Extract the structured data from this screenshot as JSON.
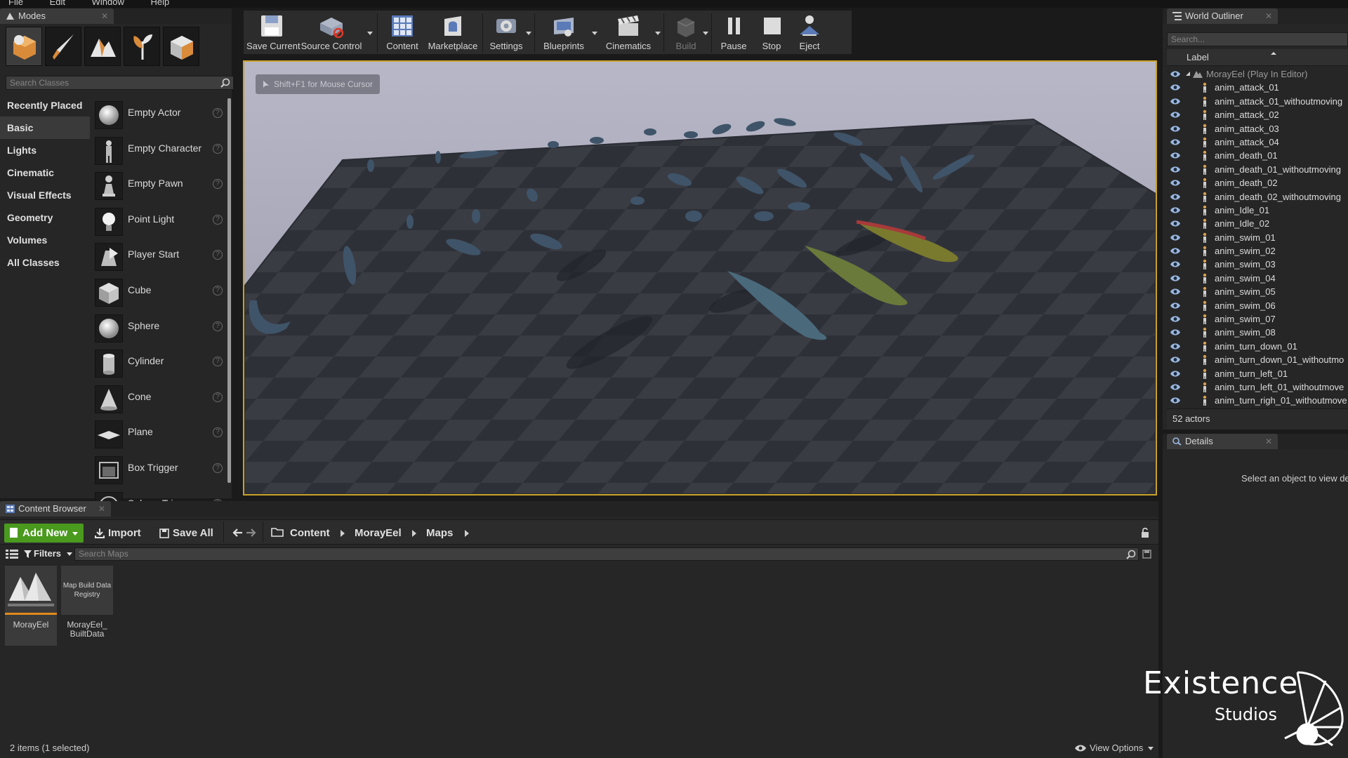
{
  "menu": [
    "File",
    "Edit",
    "Window",
    "Help"
  ],
  "modes": {
    "tab_label": "Modes",
    "search_placeholder": "Search Classes",
    "categories": [
      "Recently Placed",
      "Basic",
      "Lights",
      "Cinematic",
      "Visual Effects",
      "Geometry",
      "Volumes",
      "All Classes"
    ],
    "selected_category": "Basic",
    "items": [
      "Empty Actor",
      "Empty Character",
      "Empty Pawn",
      "Point Light",
      "Player Start",
      "Cube",
      "Sphere",
      "Cylinder",
      "Cone",
      "Plane",
      "Box Trigger",
      "Sphere Trigger"
    ]
  },
  "toolbar": {
    "save_current": "Save Current",
    "source_control": "Source Control",
    "content": "Content",
    "marketplace": "Marketplace",
    "settings": "Settings",
    "blueprints": "Blueprints",
    "cinematics": "Cinematics",
    "build": "Build",
    "pause": "Pause",
    "stop": "Stop",
    "eject": "Eject"
  },
  "viewport": {
    "mouse_hint": "Shift+F1 for Mouse Cursor"
  },
  "content_browser": {
    "tab_label": "Content Browser",
    "add_new": "Add New",
    "import": "Import",
    "save_all": "Save All",
    "breadcrumbs": [
      "Content",
      "MorayEel",
      "Maps"
    ],
    "filters": "Filters",
    "search_placeholder": "Search Maps",
    "assets": [
      {
        "name": "MorayEel",
        "selected": true
      },
      {
        "name": "MorayEel_BuiltData",
        "thumb_label": "Map Build Data Registry",
        "selected": false
      }
    ],
    "asset2_line1": "MorayEel_",
    "asset2_line2": "BuiltData",
    "status": "2 items (1 selected)",
    "view_options": "View Options"
  },
  "outliner": {
    "tab_label": "World Outliner",
    "search_placeholder": "Search...",
    "column_label": "Label",
    "root": "MorayEel (Play In Editor)",
    "actors": [
      "anim_attack_01",
      "anim_attack_01_withoutmoving",
      "anim_attack_02",
      "anim_attack_03",
      "anim_attack_04",
      "anim_death_01",
      "anim_death_01_withoutmoving",
      "anim_death_02",
      "anim_death_02_withoutmoving",
      "anim_Idle_01",
      "anim_Idle_02",
      "anim_swim_01",
      "anim_swim_02",
      "anim_swim_03",
      "anim_swim_04",
      "anim_swim_05",
      "anim_swim_06",
      "anim_swim_07",
      "anim_swim_08",
      "anim_turn_down_01",
      "anim_turn_down_01_withoutmo",
      "anim_turn_left_01",
      "anim_turn_left_01_withoutmove",
      "anim_turn_righ_01_withoutmove"
    ],
    "count": "52 actors"
  },
  "details": {
    "tab_label": "Details",
    "empty_msg": "Select an object to view de"
  },
  "logo": {
    "line1": "Existence",
    "line2": "Studios"
  },
  "colors": {
    "accent_selected": "#e08a1a",
    "add_new_green": "#4a9a1e",
    "viewport_border": "#c9a227"
  }
}
